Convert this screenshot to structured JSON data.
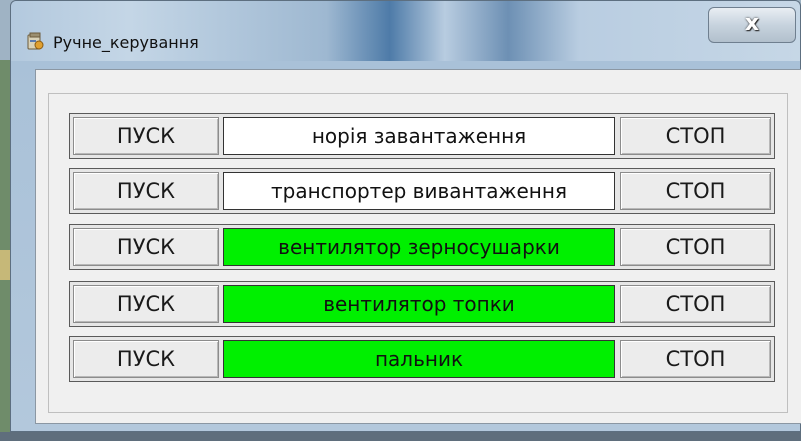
{
  "window": {
    "title": "Ручне_керування",
    "close_label": "x"
  },
  "colors": {
    "running": "#00f000",
    "stopped": "#ffffff"
  },
  "icons": {
    "app": "app-icon",
    "close": "close-icon"
  },
  "rows": [
    {
      "start_label": "ПУСК",
      "name": "норія завантаження",
      "stop_label": "СТОП",
      "running": false
    },
    {
      "start_label": "ПУСК",
      "name": "транспортер вивантаження",
      "stop_label": "СТОП",
      "running": false
    },
    {
      "start_label": "ПУСК",
      "name": "вентилятор зерносушарки",
      "stop_label": "СТОП",
      "running": true
    },
    {
      "start_label": "ПУСК",
      "name": "вентилятор топки",
      "stop_label": "СТОП",
      "running": true
    },
    {
      "start_label": "ПУСК",
      "name": "пальник",
      "stop_label": "СТОП",
      "running": true
    }
  ]
}
